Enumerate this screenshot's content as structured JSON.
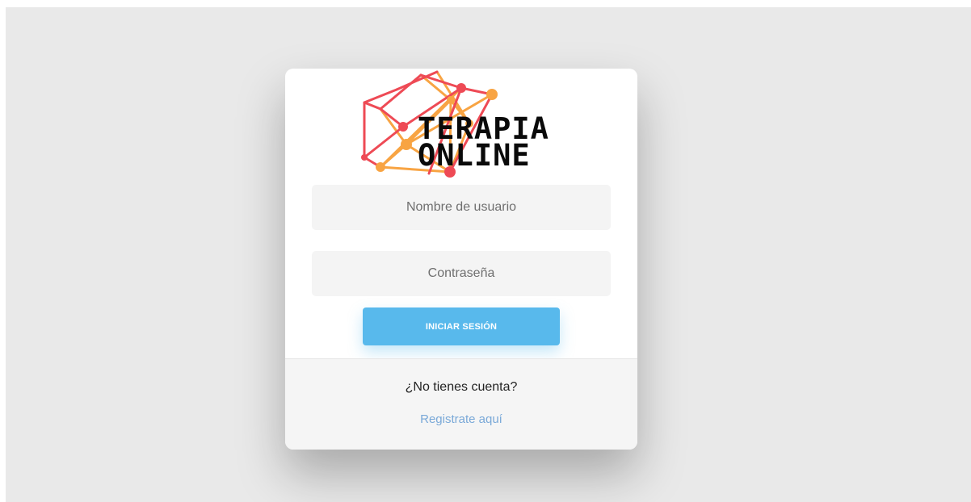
{
  "brand": {
    "logo_line1": "TERAPIA",
    "logo_line2": "ONLINE",
    "colors": {
      "network_red": "#ee4a55",
      "network_orange": "#f8a443",
      "text": "#0a0a0a"
    }
  },
  "login_form": {
    "username_placeholder": "Nombre de usuario",
    "password_placeholder": "Contraseña",
    "submit_label": "INICIAR SESIÓN"
  },
  "footer": {
    "prompt": "¿No tienes cuenta?",
    "register_link": "Registrate aquí"
  },
  "colors": {
    "page_background": "#e9e9e9",
    "card_background": "#ffffff",
    "button": "#58b9ec",
    "link": "#7aa9d8",
    "footer_background": "#f5f5f5"
  }
}
